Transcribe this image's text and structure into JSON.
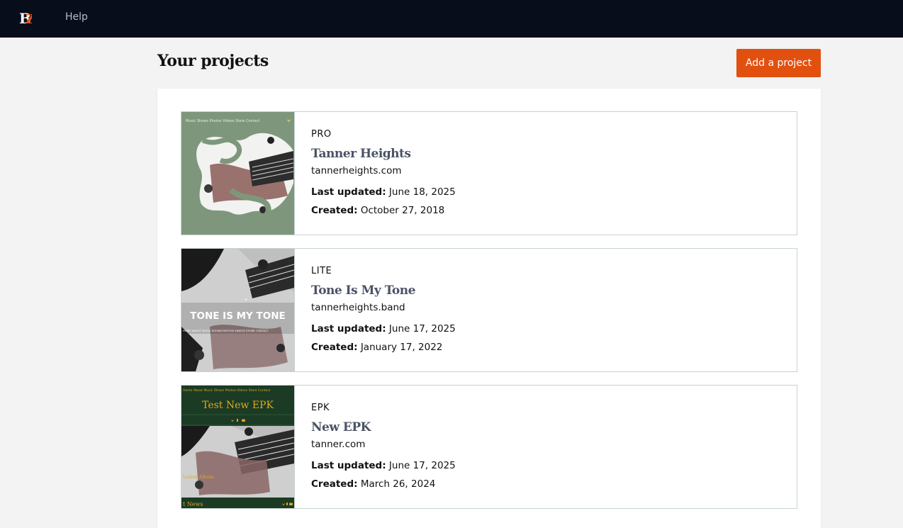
{
  "topbar": {
    "logo_text": "BZ",
    "nav": {
      "help_label": "Help"
    }
  },
  "main": {
    "title": "Your projects",
    "add_button_label": "Add a project"
  },
  "projects": [
    {
      "plan": "PRO",
      "name": "Tanner Heights",
      "domain": "tannerheights.com",
      "updated_label": "Last updated:",
      "updated": "June 18, 2025",
      "created_label": "Created:",
      "created": "October 27, 2018",
      "thumb": {
        "nav": "Music  Shows  Photos  Videos  Store  Contact"
      }
    },
    {
      "plan": "LITE",
      "name": "Tone Is My Tone",
      "domain": "tannerheights.band",
      "updated_label": "Last updated:",
      "updated": "June 17, 2025",
      "created_label": "Created:",
      "created": "January 17, 2022",
      "thumb": {
        "headline": "TONE IS MY TONE",
        "nav": "HOME  ABOUT  MUSIC  SHOWS  PHOTOS  VIDEOS  STORE  CONTACT"
      }
    },
    {
      "plan": "EPK",
      "name": "New EPK",
      "domain": "tanner.com",
      "updated_label": "Last updated:",
      "updated": "June 17, 2025",
      "created_label": "Created:",
      "created": "March 26, 2024",
      "thumb": {
        "headline": "Test New EPK",
        "nav": "Home  About  Music  Shows  Photos  Videos  Store  Contact",
        "album_label": "Latest Album",
        "news_label": "t News"
      }
    }
  ],
  "colors": {
    "topbar": "#070d1a",
    "accent": "#e2500f",
    "project_name": "#4a5365",
    "card_border": "#c7d3d1",
    "epk_gold": "#e0a81d"
  },
  "icons": [
    "logo-icon",
    "twitter-icon",
    "facebook-icon",
    "youtube-icon"
  ]
}
